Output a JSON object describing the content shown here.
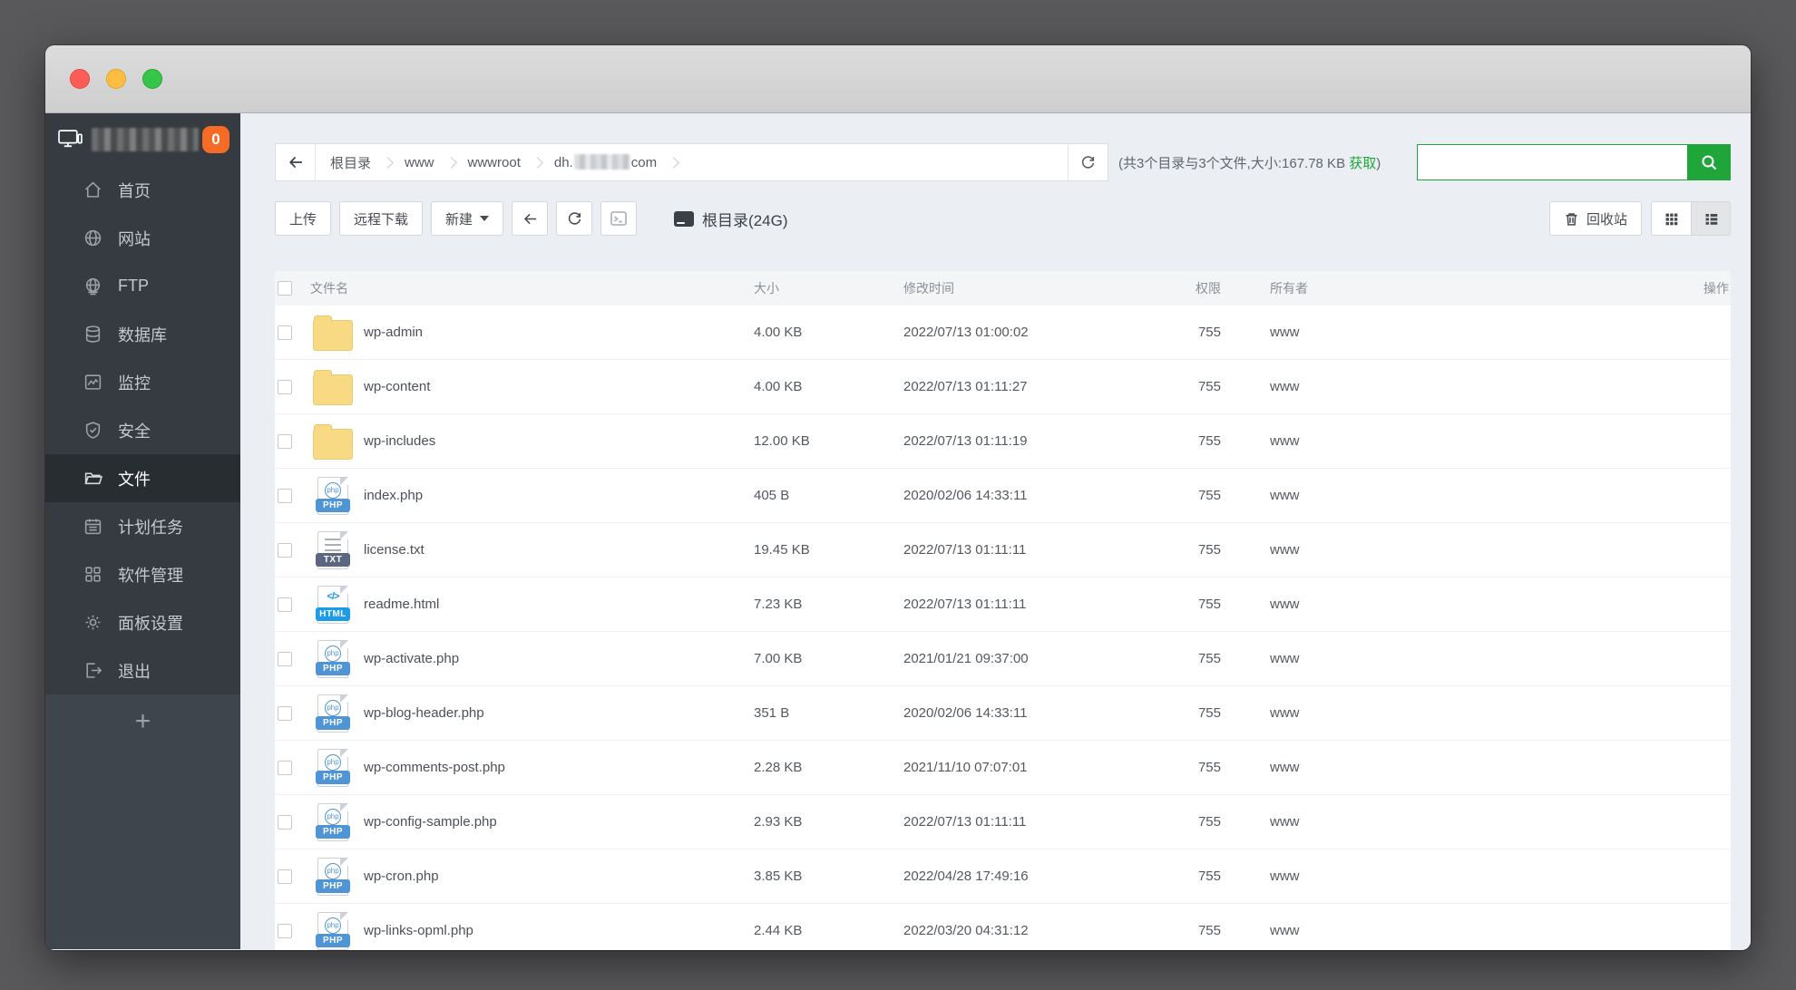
{
  "window": {
    "notification_badge": "0"
  },
  "sidebar": {
    "items": [
      {
        "label": "首页",
        "icon": "home",
        "active": false
      },
      {
        "label": "网站",
        "icon": "globe",
        "active": false
      },
      {
        "label": "FTP",
        "icon": "ftp",
        "active": false
      },
      {
        "label": "数据库",
        "icon": "database",
        "active": false
      },
      {
        "label": "监控",
        "icon": "monitor",
        "active": false
      },
      {
        "label": "安全",
        "icon": "shield",
        "active": false
      },
      {
        "label": "文件",
        "icon": "folder",
        "active": true
      },
      {
        "label": "计划任务",
        "icon": "calendar",
        "active": false
      },
      {
        "label": "软件管理",
        "icon": "apps",
        "active": false
      },
      {
        "label": "面板设置",
        "icon": "gear",
        "active": false
      },
      {
        "label": "退出",
        "icon": "logout",
        "active": false
      }
    ],
    "add_label": "+"
  },
  "breadcrumb": {
    "segments": [
      "根目录",
      "www",
      "wwwroot"
    ],
    "blurred_segment_prefix": "dh.",
    "blurred_segment_suffix": "com"
  },
  "stats": {
    "prefix": "(共3个目录与3个文件,大小:167.78 KB ",
    "link": "获取",
    "suffix": ")"
  },
  "search": {
    "value": ""
  },
  "toolbar": {
    "upload_label": "上传",
    "remote_download_label": "远程下载",
    "new_label": "新建",
    "root_label": "根目录(24G)",
    "recycle_label": "回收站"
  },
  "table": {
    "headers": {
      "name": "文件名",
      "size": "大小",
      "mtime": "修改时间",
      "perm": "权限",
      "owner": "所有者",
      "action": "操作"
    },
    "rows": [
      {
        "name": "wp-admin",
        "type": "folder",
        "size": "4.00 KB",
        "mtime": "2022/07/13 01:00:02",
        "perm": "755",
        "owner": "www"
      },
      {
        "name": "wp-content",
        "type": "folder",
        "size": "4.00 KB",
        "mtime": "2022/07/13 01:11:27",
        "perm": "755",
        "owner": "www"
      },
      {
        "name": "wp-includes",
        "type": "folder",
        "size": "12.00 KB",
        "mtime": "2022/07/13 01:11:19",
        "perm": "755",
        "owner": "www"
      },
      {
        "name": "index.php",
        "type": "php",
        "size": "405 B",
        "mtime": "2020/02/06 14:33:11",
        "perm": "755",
        "owner": "www"
      },
      {
        "name": "license.txt",
        "type": "txt",
        "size": "19.45 KB",
        "mtime": "2022/07/13 01:11:11",
        "perm": "755",
        "owner": "www"
      },
      {
        "name": "readme.html",
        "type": "html",
        "size": "7.23 KB",
        "mtime": "2022/07/13 01:11:11",
        "perm": "755",
        "owner": "www"
      },
      {
        "name": "wp-activate.php",
        "type": "php",
        "size": "7.00 KB",
        "mtime": "2021/01/21 09:37:00",
        "perm": "755",
        "owner": "www"
      },
      {
        "name": "wp-blog-header.php",
        "type": "php",
        "size": "351 B",
        "mtime": "2020/02/06 14:33:11",
        "perm": "755",
        "owner": "www"
      },
      {
        "name": "wp-comments-post.php",
        "type": "php",
        "size": "2.28 KB",
        "mtime": "2021/11/10 07:07:01",
        "perm": "755",
        "owner": "www"
      },
      {
        "name": "wp-config-sample.php",
        "type": "php",
        "size": "2.93 KB",
        "mtime": "2022/07/13 01:11:11",
        "perm": "755",
        "owner": "www"
      },
      {
        "name": "wp-cron.php",
        "type": "php",
        "size": "3.85 KB",
        "mtime": "2022/04/28 17:49:16",
        "perm": "755",
        "owner": "www"
      },
      {
        "name": "wp-links-opml.php",
        "type": "php",
        "size": "2.44 KB",
        "mtime": "2022/03/20 04:31:12",
        "perm": "755",
        "owner": "www"
      }
    ]
  },
  "file_types": {
    "php": {
      "badge": "PHP",
      "badge_color": "#4f94d4"
    },
    "txt": {
      "badge": "TXT",
      "badge_color": "#5b6780"
    },
    "html": {
      "badge": "HTML",
      "badge_color": "#1c9be9"
    }
  },
  "colors": {
    "accent_green": "#20a53a",
    "badge_orange": "#f66b25",
    "folder_yellow": "#f8d984"
  }
}
